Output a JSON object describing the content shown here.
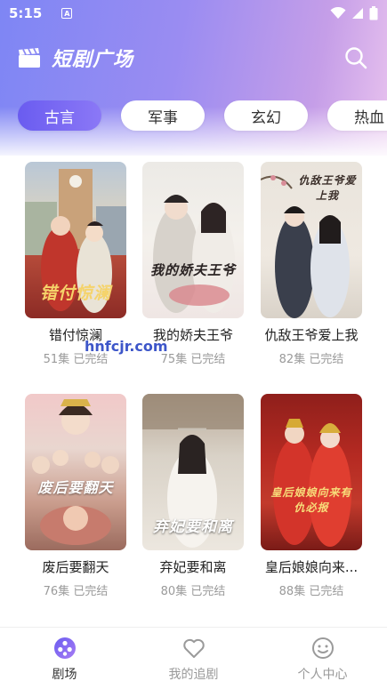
{
  "status_bar": {
    "time": "5:15",
    "notification_letter": "A"
  },
  "header": {
    "title": "短剧广场",
    "icon": "clapperboard-icon",
    "search_icon": "search-icon"
  },
  "tabs": [
    {
      "label": "古言",
      "active": true
    },
    {
      "label": "军事",
      "active": false
    },
    {
      "label": "玄幻",
      "active": false
    },
    {
      "label": "热血",
      "active": false
    }
  ],
  "dramas": [
    {
      "title": "错付惊澜",
      "meta": "51集 已完结",
      "poster_text": "错付惊澜"
    },
    {
      "title": "我的娇夫王爷",
      "meta": "75集 已完结",
      "poster_text": "我的娇夫王爷"
    },
    {
      "title": "仇敌王爷爱上我",
      "meta": "82集 已完结",
      "poster_text": "仇敌王爷爱上我"
    },
    {
      "title": "废后要翻天",
      "meta": "76集 已完结",
      "poster_text": "废后要翻天"
    },
    {
      "title": "弃妃要和离",
      "meta": "80集 已完结",
      "poster_text": "弃妃要和离"
    },
    {
      "title": "皇后娘娘向来...",
      "meta": "88集 已完结",
      "poster_text": "皇后娘娘向来有仇必报"
    }
  ],
  "watermark": "hnfcjr.com",
  "bottom_nav": [
    {
      "label": "剧场",
      "icon": "theater-icon",
      "active": true
    },
    {
      "label": "我的追剧",
      "icon": "heart-icon",
      "active": false
    },
    {
      "label": "个人中心",
      "icon": "smiley-icon",
      "active": false
    }
  ],
  "colors": {
    "accent": "#6a5cf0",
    "header_gradient_start": "#7e86f4",
    "header_gradient_end": "#e8c2ee",
    "meta_text": "#9a9a9a"
  }
}
